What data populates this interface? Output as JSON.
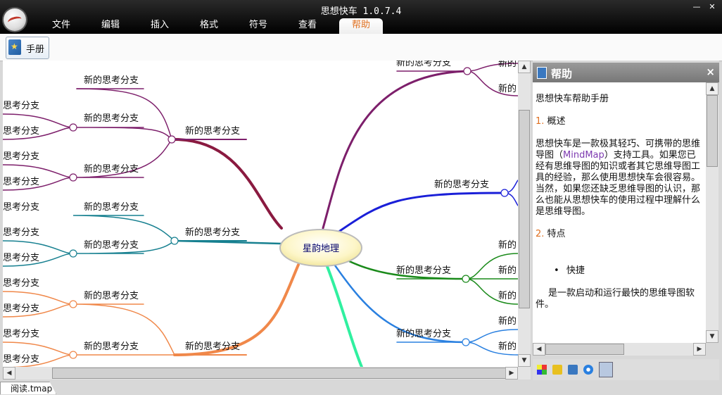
{
  "app": {
    "title": "思想快车 1.0.7.4"
  },
  "menu": [
    {
      "label": "文件"
    },
    {
      "label": "编辑"
    },
    {
      "label": "插入"
    },
    {
      "label": "格式"
    },
    {
      "label": "符号"
    },
    {
      "label": "查看"
    },
    {
      "label": "帮助",
      "active": true
    }
  ],
  "ribbon": {
    "manual_label": "手册"
  },
  "mindmap": {
    "center": "星韵地理",
    "branch_label": "新的思考分支",
    "branch_label_short": "新的",
    "branch_label_tail": "思考分支",
    "colors": {
      "purple": "#7d1f6b",
      "maroon": "#8a1a40",
      "teal": "#178090",
      "orange": "#f0884a",
      "blue": "#1a1fd8",
      "green": "#1a8a1a",
      "lightblue": "#2a80e0",
      "mint": "#30f0a0"
    }
  },
  "help_panel": {
    "title": "帮助",
    "close": "×",
    "content": {
      "heading": "思想快车帮助手册",
      "section1_num": "1.",
      "section1_title": "概述",
      "para1_a": "思想快车是一款极其轻巧、可携带的思维导图（",
      "para1_link": "MindMap",
      "para1_b": "）支持工具。如果您已经有思维导图的知识或者其它思维导图工具的经验，那么使用思想快车会很容易。当然，如果您还缺乏思维导图的认识，那么也能从思想快车的使用过程中理解什么是思维导图。",
      "section2_num": "2.",
      "section2_title": "特点",
      "bullet1": "快捷",
      "para2": "是一款启动和运行最快的思维导图软件。"
    }
  },
  "status": {
    "file_tab": "阅读.tmap"
  }
}
